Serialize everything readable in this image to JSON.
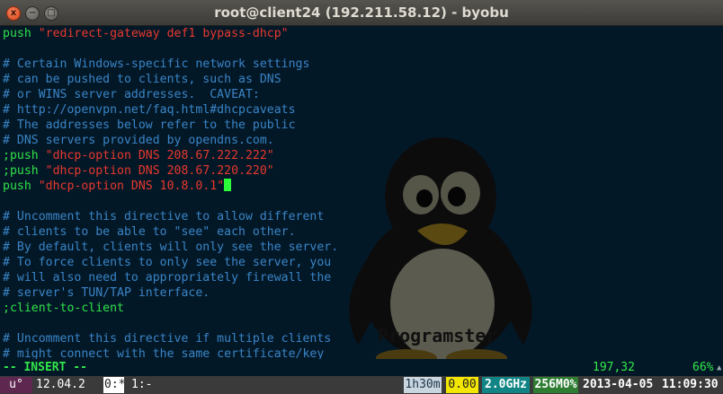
{
  "window": {
    "title": "root@client24 (192.211.58.12) - byobu",
    "close_glyph": "x",
    "minimize_glyph": "−",
    "maximize_glyph": "□"
  },
  "watermark": {
    "text": "Programster"
  },
  "lines": [
    [
      {
        "c": "kw",
        "t": "push"
      },
      {
        "c": "str",
        "t": " \"redirect-gateway def1 bypass-dhcp\""
      }
    ],
    [],
    [
      {
        "c": "cmt",
        "t": "# Certain Windows-specific network settings"
      }
    ],
    [
      {
        "c": "cmt",
        "t": "# can be pushed to clients, such as DNS"
      }
    ],
    [
      {
        "c": "cmt",
        "t": "# or WINS server addresses.  CAVEAT:"
      }
    ],
    [
      {
        "c": "cmt",
        "t": "# http://openvpn.net/faq.html#dhcpcaveats"
      }
    ],
    [
      {
        "c": "cmt",
        "t": "# The addresses below refer to the public"
      }
    ],
    [
      {
        "c": "cmt",
        "t": "# DNS servers provided by opendns.com."
      }
    ],
    [
      {
        "c": "kw",
        "t": ";push"
      },
      {
        "c": "str",
        "t": " \"dhcp-option DNS 208.67.222.222\""
      }
    ],
    [
      {
        "c": "kw",
        "t": ";push"
      },
      {
        "c": "str",
        "t": " \"dhcp-option DNS 208.67.220.220\""
      }
    ],
    [
      {
        "c": "kw",
        "t": "push"
      },
      {
        "c": "str",
        "t": " \"dhcp-option DNS 10.8.0.1\""
      },
      {
        "c": "cursor",
        "t": ""
      }
    ],
    [],
    [
      {
        "c": "cmt",
        "t": "# Uncomment this directive to allow different"
      }
    ],
    [
      {
        "c": "cmt",
        "t": "# clients to be able to \"see\" each other."
      }
    ],
    [
      {
        "c": "cmt",
        "t": "# By default, clients will only see the server."
      }
    ],
    [
      {
        "c": "cmt",
        "t": "# To force clients to only see the server, you"
      }
    ],
    [
      {
        "c": "cmt",
        "t": "# will also need to appropriately firewall the"
      }
    ],
    [
      {
        "c": "cmt",
        "t": "# server's TUN/TAP interface."
      }
    ],
    [
      {
        "c": "kw",
        "t": ";client-to-client"
      }
    ],
    [],
    [
      {
        "c": "cmt",
        "t": "# Uncomment this directive if multiple clients"
      }
    ],
    [
      {
        "c": "cmt",
        "t": "# might connect with the same certificate/key"
      }
    ]
  ],
  "vim": {
    "mode": "-- INSERT --",
    "position": "197,32",
    "percent": "66%"
  },
  "byobu": {
    "logo": "u°",
    "release": "12.04.2",
    "window0": "0:*",
    "window1": "1:-",
    "uptime": "1h30m",
    "load": "0.00",
    "cpu_freq": "2.0GHz",
    "memory": "256M0%",
    "date": "2013-04-05",
    "time": "11:09:30"
  },
  "colors": {
    "terminal_bg": "#031827",
    "keyword": "#2fe24a",
    "string": "#e8382e",
    "comment": "#3a84c6",
    "cursor": "#2bff3a"
  }
}
